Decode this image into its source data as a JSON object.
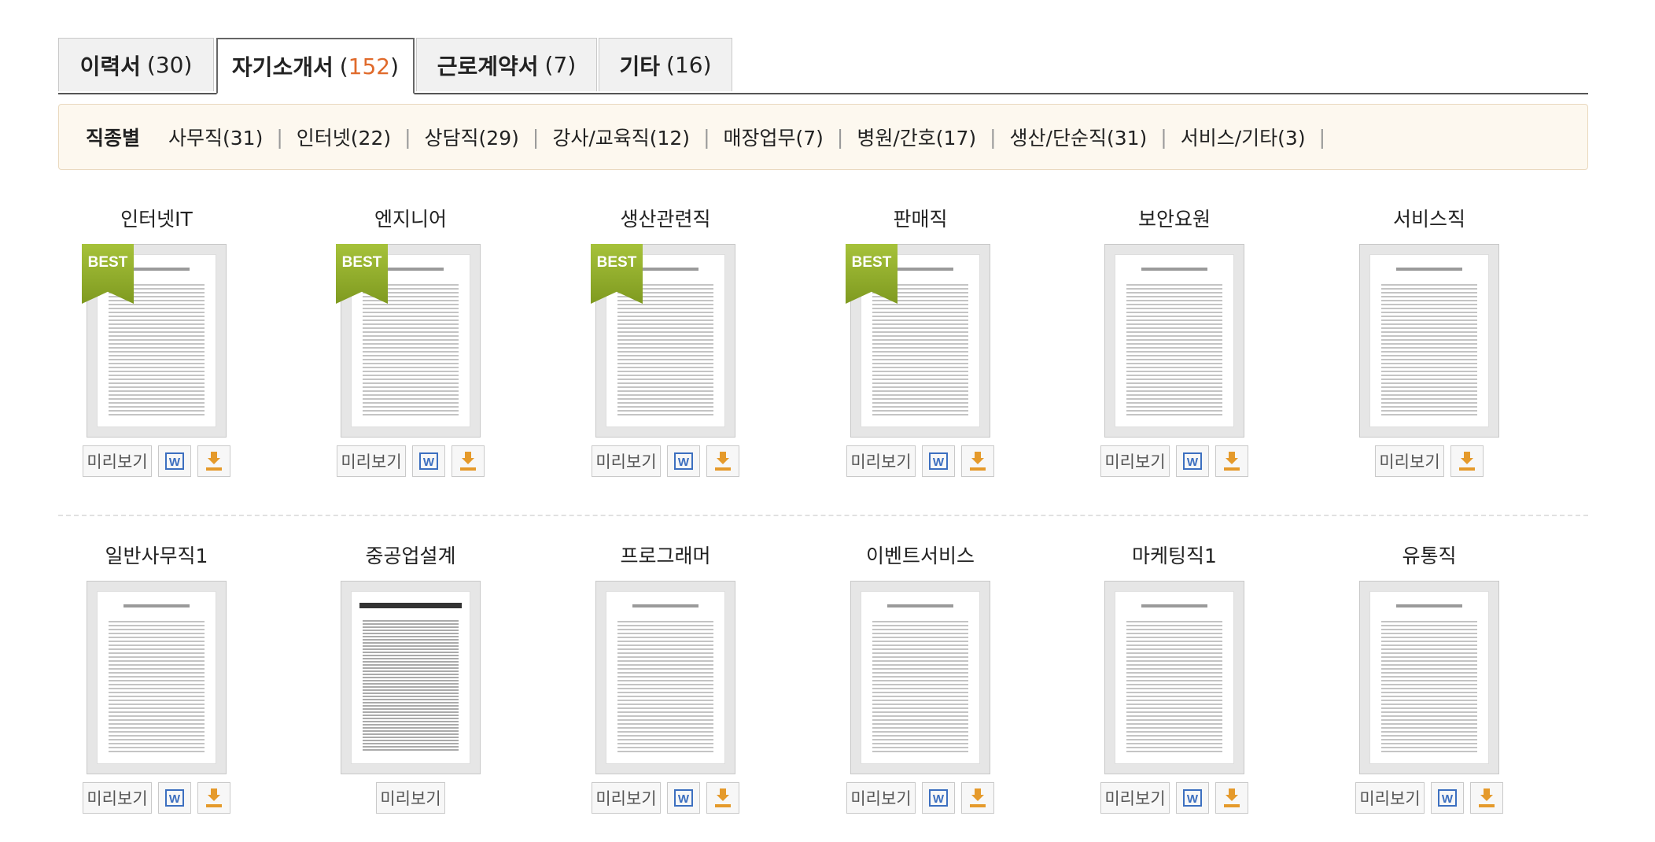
{
  "tabs": [
    {
      "name": "이력서",
      "open": "(",
      "num": "30",
      "close": ")"
    },
    {
      "name": "자기소개서",
      "open": "(",
      "num": "152",
      "close": ")"
    },
    {
      "name": "근로계약서",
      "open": "(",
      "num": "7",
      "close": ")"
    },
    {
      "name": "기타",
      "open": "(",
      "num": "16",
      "close": ")"
    }
  ],
  "active_tab_color": "#e06a2b",
  "filter": {
    "label": "직종별",
    "items": [
      "사무직(31)",
      "인터넷(22)",
      "상담직(29)",
      "강사/교육직(12)",
      "매장업무(7)",
      "병원/간호(17)",
      "생산/단순직(31)",
      "서비스/기타(3)"
    ],
    "separator": "|"
  },
  "badge_text": "BEST",
  "preview_label": "미리보기",
  "word_icon_letter": "W",
  "rows": [
    {
      "cards": [
        {
          "title": "인터넷IT",
          "best": true,
          "word": true,
          "download": true
        },
        {
          "title": "엔지니어",
          "best": true,
          "word": true,
          "download": true
        },
        {
          "title": "생산관련직",
          "best": true,
          "word": true,
          "download": true
        },
        {
          "title": "판매직",
          "best": true,
          "word": true,
          "download": true
        },
        {
          "title": "보안요원",
          "best": false,
          "word": true,
          "download": true
        },
        {
          "title": "서비스직",
          "best": false,
          "word": false,
          "download": true
        }
      ]
    },
    {
      "cards": [
        {
          "title": "일반사무직1",
          "best": false,
          "word": true,
          "download": true
        },
        {
          "title": "중공업설계",
          "best": false,
          "word": false,
          "download": false
        },
        {
          "title": "프로그래머",
          "best": false,
          "word": true,
          "download": true
        },
        {
          "title": "이벤트서비스",
          "best": false,
          "word": true,
          "download": true
        },
        {
          "title": "마케팅직1",
          "best": false,
          "word": true,
          "download": true
        },
        {
          "title": "유통직",
          "best": false,
          "word": true,
          "download": true
        }
      ]
    }
  ]
}
